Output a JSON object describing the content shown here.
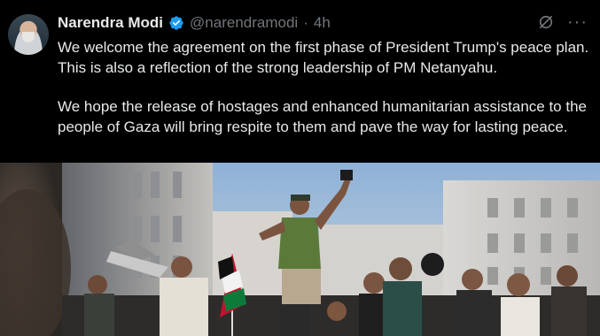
{
  "post": {
    "author_name": "Narendra Modi",
    "handle": "@narendramodi",
    "separator": "·",
    "timestamp": "4h",
    "verified_badge": "verified-badge-icon",
    "more_icon_glyph": "···",
    "paragraphs": [
      "We welcome the agreement on the first phase of President Trump's peace plan. This is also a reflection of the strong leadership of PM Netanyahu.",
      "We hope the release of hostages and enhanced humanitarian assistance to the people of Gaza will bring respite to them and pave the way for lasting peace."
    ]
  },
  "icons": {
    "avatar": "avatar-photo",
    "grok": "grok-icon",
    "more": "more-options-icon"
  },
  "colors": {
    "background": "#000000",
    "text_primary": "#e7e9ea",
    "text_secondary": "#71767b",
    "verified_blue": "#1d9bf0"
  },
  "media": {
    "type": "photo",
    "description_icon": "news-photo"
  }
}
